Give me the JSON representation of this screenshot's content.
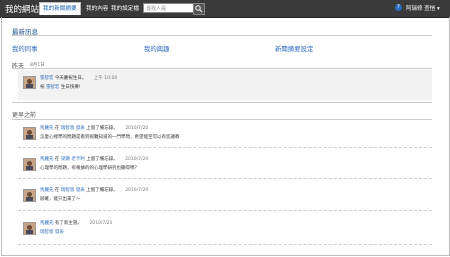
{
  "header": {
    "site_title": "我的網站",
    "nav": [
      {
        "label": "我的新聞摘要"
      },
      {
        "label": "我的內容"
      },
      {
        "label": "我的設定檔"
      }
    ],
    "search_placeholder": "尋找人員",
    "help": "?",
    "user": "阿瑞修 查愷 ▾"
  },
  "main": {
    "title": "最新訊息",
    "links": [
      "我的同事",
      "我的興趣",
      "新聞摘要設定"
    ],
    "today": {
      "label": "昨天",
      "date": "8月1日",
      "item": {
        "name": "張智宏",
        "text": "今天慶祝生日。",
        "time": "上午 10:00",
        "line2_prefix": "祝 ",
        "line2_name": "張智宏",
        "line2_suffix": " 生日快樂!"
      }
    },
    "earlier": {
      "label": "更早之前",
      "items": [
        {
          "name": "馬麗先",
          "mid": " 在 ",
          "target": "瑞智恩 發表",
          "action": " 上留了備忘錄。",
          "date": "2010/7/20",
          "text": "怎麼心裡學的問題是看到很難知道的一門學問，希望能空可以有您議教"
        },
        {
          "name": "馬麗先",
          "mid": " 在 ",
          "target": "梁顯 老卡利",
          "action": " 上留了備忘錄。",
          "date": "2010/7/20",
          "text": "心理學的問題，有根據的的心理學研究也顯得嗎？"
        },
        {
          "name": "馬麗先",
          "mid": " 在 ",
          "target": "瑞智恩 發表",
          "action": " 上留了備忘錄。",
          "date": "2010/7/20",
          "text": "辦確，能只出來了～"
        },
        {
          "name": "馬麗先",
          "mid": "",
          "target": "",
          "action": " 有了新主管。",
          "date": "2010/7/21",
          "line2_name": "瑞智恩 發表"
        }
      ]
    }
  }
}
